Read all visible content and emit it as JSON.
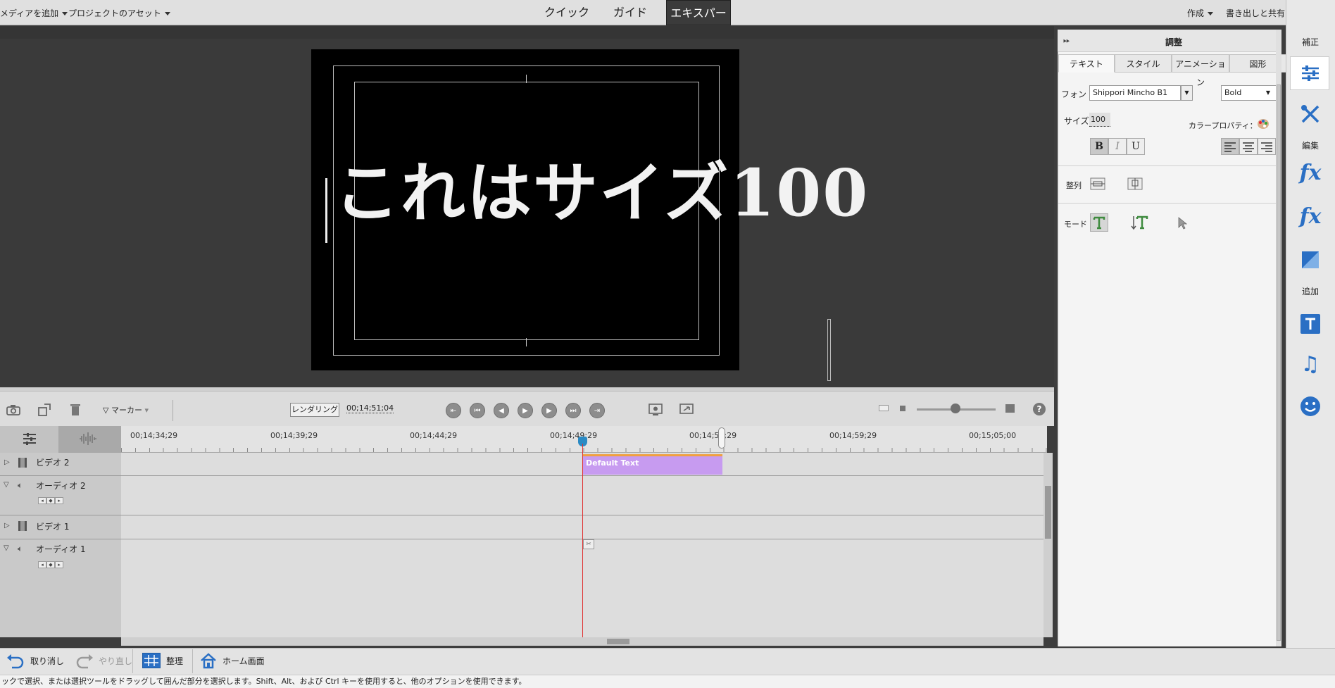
{
  "topbar": {
    "add_media": "メディアを追加",
    "project_assets": "プロジェクトのアセット",
    "modes": [
      "クイック",
      "ガイド",
      "エキスパート"
    ],
    "active_mode": "エキスパート",
    "create": "作成",
    "export_share": "書き出しと共有",
    "settings_icon": "gear-icon"
  },
  "preview": {
    "title_text": "これはサイズ100"
  },
  "timeline_toolbar": {
    "marker_label": "マーカー",
    "render_label": "レンダリング",
    "timecode": "00;14;51;04",
    "help_label": "?"
  },
  "ruler": {
    "ticks": [
      "00;14;34;29",
      "00;14;39;29",
      "00;14;44;29",
      "00;14;49;29",
      "00;14;54;29",
      "00;14;59;29",
      "00;15;05;00"
    ]
  },
  "tracks": [
    {
      "name": "ビデオ 2",
      "type": "video"
    },
    {
      "name": "オーディオ 2",
      "type": "audio"
    },
    {
      "name": "ビデオ 1",
      "type": "video"
    },
    {
      "name": "オーディオ 1",
      "type": "audio"
    }
  ],
  "clip": {
    "label": "Default Text",
    "color": "#c79bf0"
  },
  "bottombar": {
    "undo": "取り消し",
    "redo": "やり直し",
    "organize": "整理",
    "home": "ホーム画面"
  },
  "status_text": "ックで選択、または選択ツールをドラッグして囲んだ部分を選択します。Shift、Alt、および Ctrl キーを使用すると、他のオプションを使用できます。",
  "panel": {
    "title": "調整",
    "tabs": [
      "テキスト",
      "スタイル",
      "アニメーション",
      "図形"
    ],
    "active_tab": "テキスト",
    "font_label": "フォント",
    "font_value": "Shippori Mincho B1",
    "weight_value": "Bold",
    "size_label": "サイズ",
    "size_value": "100",
    "color_label": "カラープロパティ：",
    "bold": "B",
    "italic": "I",
    "underline": "U",
    "arrange_label": "整列",
    "mode_label": "モード"
  },
  "rail": {
    "correct": "補正",
    "edit": "編集",
    "add": "追加"
  },
  "colors": {
    "accent": "#2a6fc4",
    "playhead": "#e03030",
    "clip_top": "#f0a040"
  }
}
